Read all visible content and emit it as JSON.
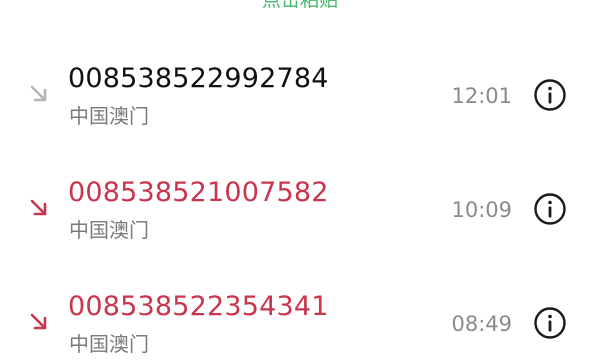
{
  "header": {
    "action_text": "点击粘贴"
  },
  "calls": [
    {
      "number": "008538522992784",
      "location": "中国澳门",
      "time": "12:01",
      "direction_icon": "incoming-call-arrow-icon",
      "status": "incoming",
      "number_color": "#111111",
      "icon_color": "#b5b5b5"
    },
    {
      "number": "008538521007582",
      "location": "中国澳门",
      "time": "10:09",
      "direction_icon": "missed-call-arrow-icon",
      "status": "missed",
      "number_color": "#c8354d",
      "icon_color": "#c8354d"
    },
    {
      "number": "008538522354341",
      "location": "中国澳门",
      "time": "08:49",
      "direction_icon": "missed-call-arrow-icon",
      "status": "missed",
      "number_color": "#c8354d",
      "icon_color": "#c8354d"
    }
  ],
  "icons": {
    "info": "info-circle-icon"
  }
}
